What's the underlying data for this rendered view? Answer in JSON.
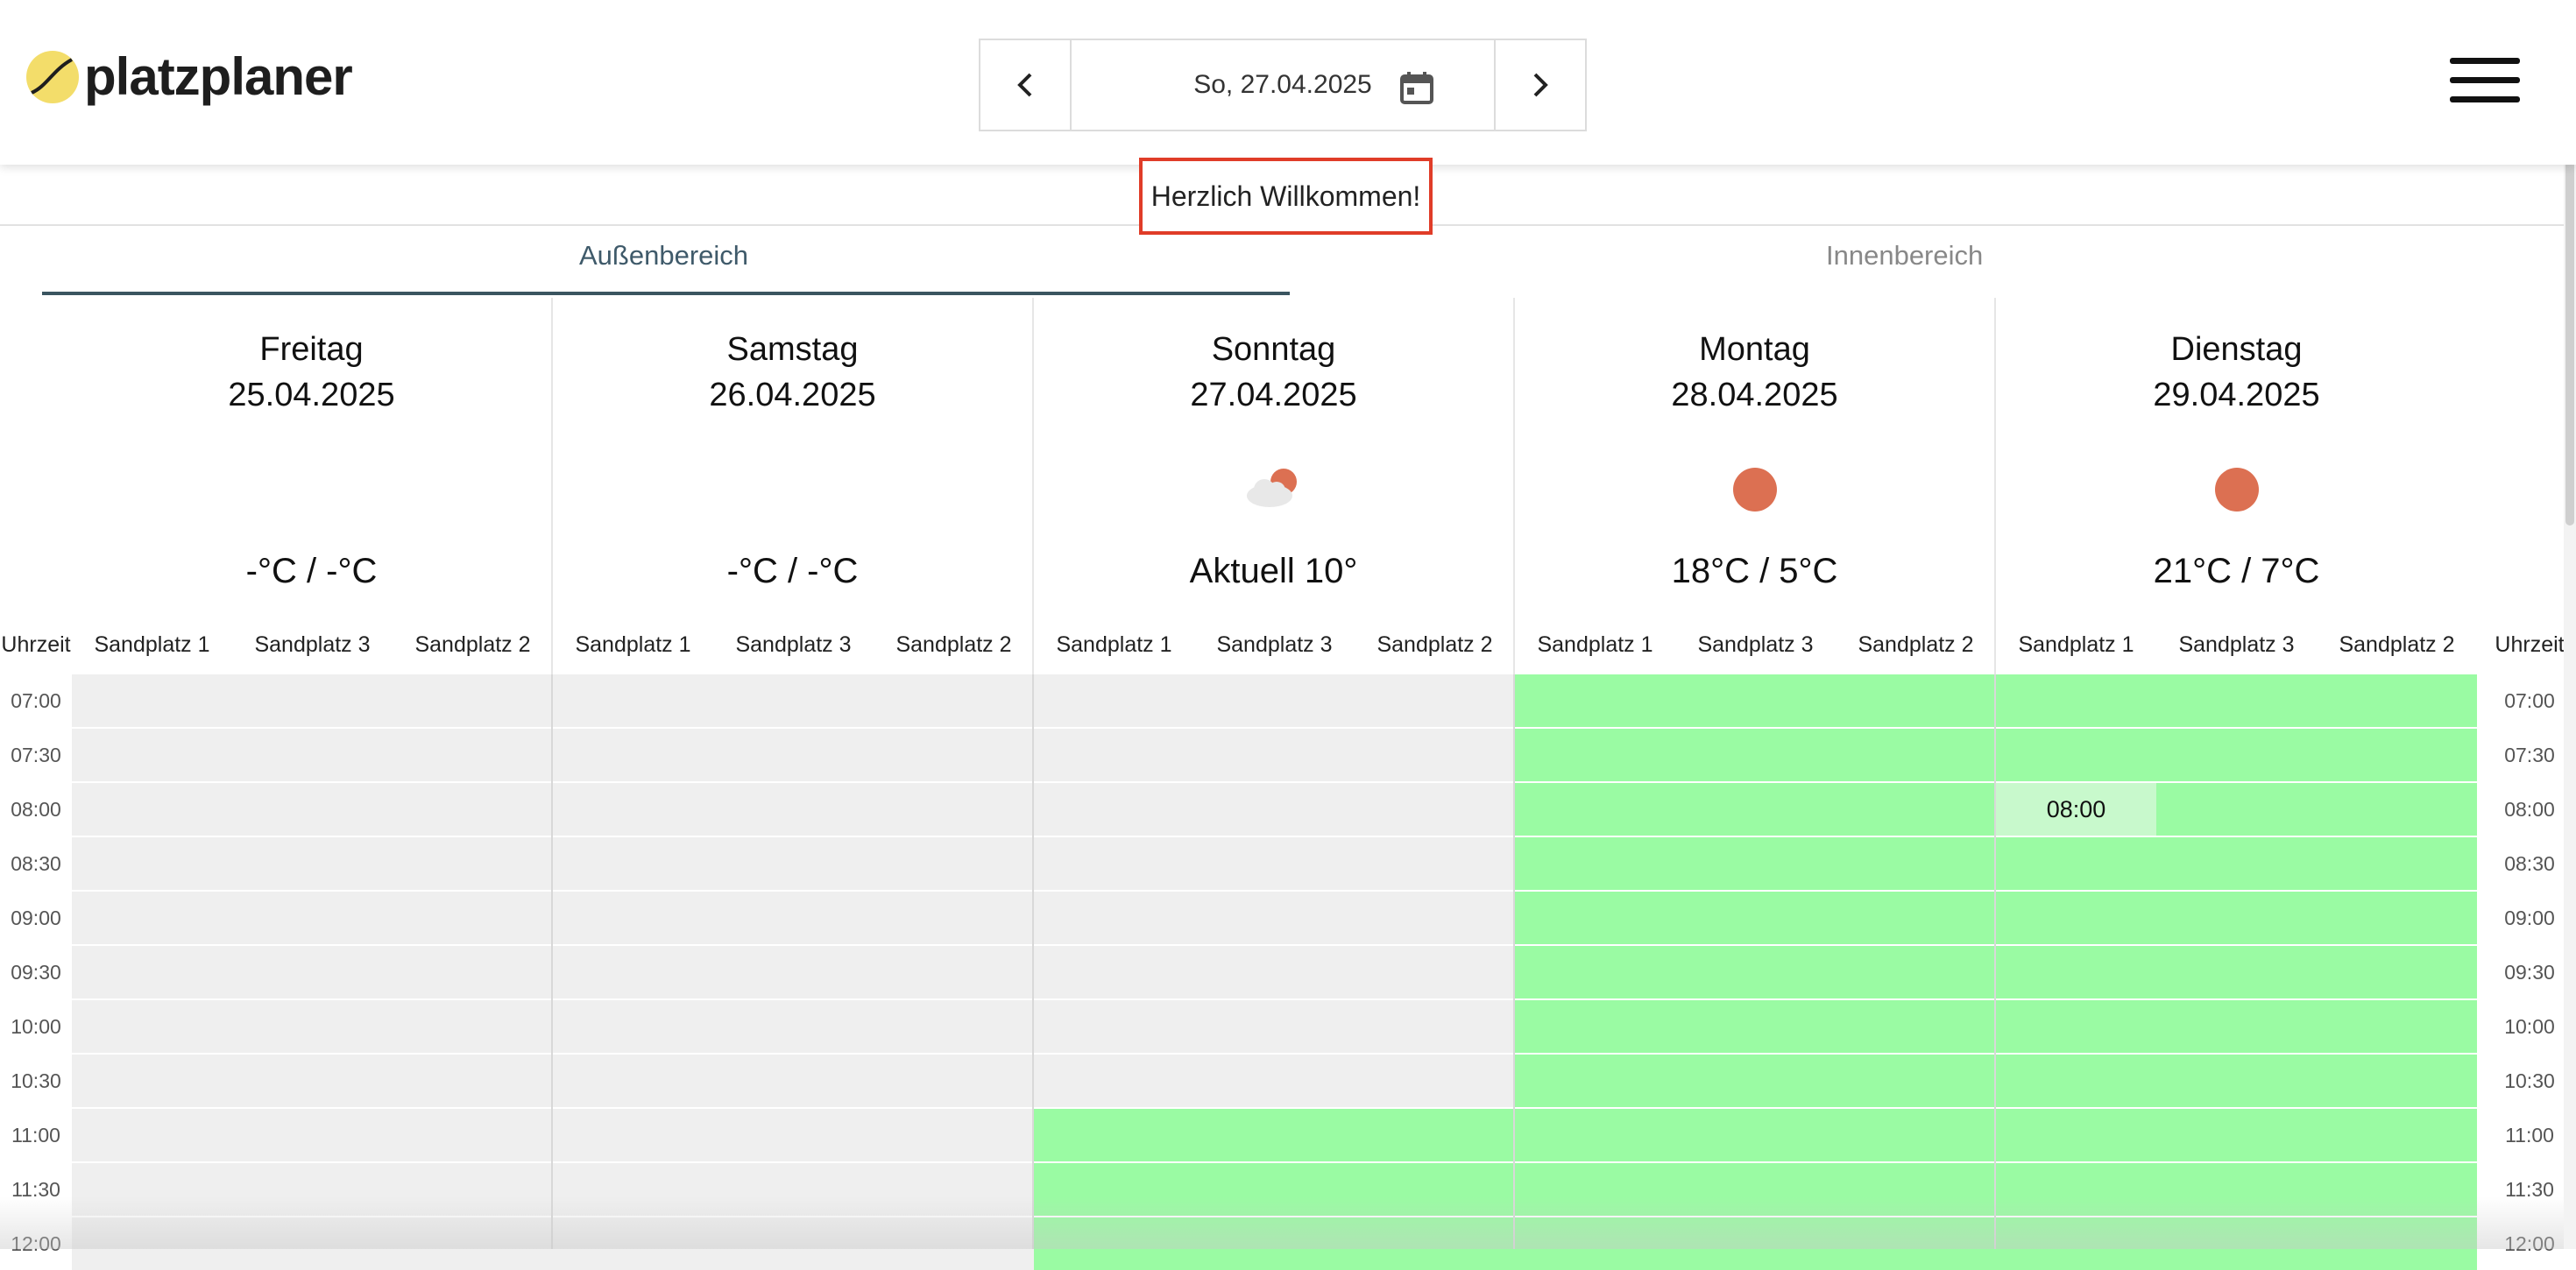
{
  "header": {
    "logo_text": "platzplaner",
    "current_date": "So, 27.04.2025",
    "prev_icon": "chevron-left-icon",
    "next_icon": "chevron-right-icon",
    "calendar_icon": "calendar-icon",
    "menu_icon": "hamburger-menu-icon"
  },
  "welcome": "Herzlich Willkommen!",
  "tabs": [
    {
      "label": "Außenbereich",
      "active": true
    },
    {
      "label": "Innenbereich",
      "active": false
    }
  ],
  "days": [
    {
      "name": "Freitag",
      "date": "25.04.2025",
      "weather_icon": "",
      "temp": "-°C / -°C"
    },
    {
      "name": "Samstag",
      "date": "26.04.2025",
      "weather_icon": "",
      "temp": "-°C / -°C"
    },
    {
      "name": "Sonntag",
      "date": "27.04.2025",
      "weather_icon": "partly-cloudy-icon",
      "temp": "Aktuell 10°"
    },
    {
      "name": "Montag",
      "date": "28.04.2025",
      "weather_icon": "sun-icon",
      "temp": "18°C / 5°C"
    },
    {
      "name": "Dienstag",
      "date": "29.04.2025",
      "weather_icon": "sun-icon",
      "temp": "21°C / 7°C"
    }
  ],
  "courts": [
    "Sandplatz 1",
    "Sandplatz 3",
    "Sandplatz 2"
  ],
  "time_label": "Uhrzeit",
  "times": [
    "07:00",
    "07:30",
    "08:00",
    "08:30",
    "09:00",
    "09:30",
    "10:00",
    "10:30",
    "11:00",
    "11:30",
    "12:00"
  ],
  "availability_start_index": [
    null,
    null,
    8,
    0,
    0
  ],
  "highlight": {
    "day": 4,
    "court": 0,
    "time_index": 2,
    "label": "08:00"
  },
  "colors": {
    "available": "#9afba3",
    "unavailable": "#efefef",
    "highlight": "#c8f9cc",
    "sun": "#dc7052",
    "accent_tab": "#3a5560",
    "welcome_border": "#e03c28"
  }
}
